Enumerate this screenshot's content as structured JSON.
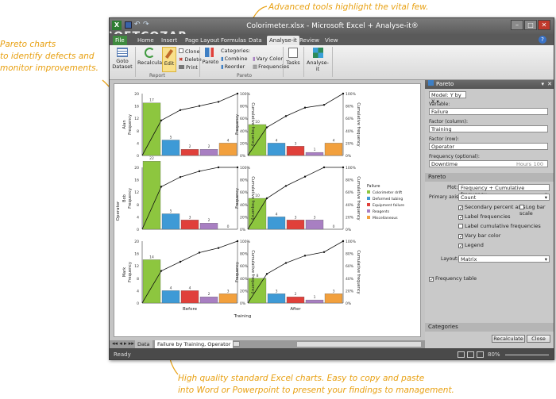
{
  "callouts": {
    "top": "Advanced tools highlight the vital few.",
    "left_line1": "Pareto charts",
    "left_line2": "to identify defects and",
    "left_line3": "monitor improvements.",
    "bottom_line1": "High quality standard Excel charts. Easy to copy and paste",
    "bottom_line2": "into Word or Powerpoint to present your findings to management."
  },
  "watermark": "SOFTCOZAR",
  "window": {
    "title": "Colorimeter.xlsx - Microsoft Excel + Analyse-it®"
  },
  "tabs": [
    "File",
    "Home",
    "Insert",
    "Page Layout",
    "Formulas",
    "Data",
    "Analyse-it",
    "Review",
    "View"
  ],
  "ribbon": {
    "goto_dataset": "Goto Dataset",
    "recalculate": "Recalculate",
    "edit": "Edit",
    "clone": "Clone",
    "delete": "Delete",
    "print": "Print",
    "report_group": "Report",
    "pareto": "Pareto",
    "categories": "Categories:",
    "combine": "Combine",
    "reorder": "Reorder",
    "vary_color": "Vary Color",
    "frequencies": "Frequencies",
    "pareto_group": "Pareto",
    "tasks": "Tasks",
    "analyse_it": "Analyse-it"
  },
  "sheet_tabs": {
    "data": "Data",
    "active": "Failure by Training, Operator"
  },
  "status": {
    "ready": "Ready",
    "zoom": "80%"
  },
  "chart_data": {
    "type": "bar",
    "categories": [
      "Colorimeter drift",
      "Deformed tubing",
      "Equipment failure",
      "Reagents",
      "Miscellaneous"
    ],
    "category_colors": [
      "#8dc63f",
      "#3e9ad6",
      "#e0403a",
      "#a87fc2",
      "#f2a03d"
    ],
    "legend_title": "Failure",
    "x_group_label": "Training",
    "row_axis_label": "Operator",
    "y_axis_label": "Frequency",
    "y2_axis_label": "Cumulative frequency",
    "y_ticks": [
      0,
      2,
      4,
      6,
      8,
      10,
      12,
      14,
      16,
      18,
      20
    ],
    "y2_ticks": [
      "0%",
      "20%",
      "40%",
      "60%",
      "80%",
      "100%"
    ],
    "x_groups": [
      "Before",
      "After"
    ],
    "row_labels": [
      "Alan",
      "Bob",
      "Mark"
    ],
    "panels": [
      {
        "row": "Alan",
        "col": "Before",
        "values": [
          17,
          5,
          2,
          2,
          4
        ]
      },
      {
        "row": "Alan",
        "col": "After",
        "values": [
          10,
          4,
          3,
          1,
          4
        ]
      },
      {
        "row": "Bob",
        "col": "Before",
        "values": [
          22,
          5,
          3,
          2,
          0
        ]
      },
      {
        "row": "Bob",
        "col": "After",
        "values": [
          10,
          4,
          3,
          3,
          0
        ]
      },
      {
        "row": "Mark",
        "col": "Before",
        "values": [
          14,
          4,
          4,
          2,
          3
        ]
      },
      {
        "row": "Mark",
        "col": "After",
        "values": [
          8,
          3,
          2,
          1,
          3
        ]
      }
    ]
  },
  "panel": {
    "title": "Pareto",
    "model": "Model: Y by X",
    "variable_label": "Variable:",
    "variable_value": "Failure",
    "factor_col_label": "Factor (column):",
    "factor_col_value": "Training",
    "factor_row_label": "Factor (row):",
    "factor_row_value": "Operator",
    "freq_label": "Frequency (optional):",
    "freq_value": "Downtime",
    "freq_hint": "Hours",
    "freq_units": "100",
    "section_pareto": "Pareto",
    "plot_label": "Plot:",
    "plot_value": "Frequency + Cumulative frequency",
    "primary_axis_label": "Primary axis:",
    "primary_axis_value": "Count",
    "secondary_percent_axis": "Secondary percent axis",
    "log_bar_axis": "Log bar scale",
    "label_frequencies": "Label frequencies",
    "label_cumulative": "Label cumulative frequencies",
    "vary_bar_color": "Vary bar color",
    "legend": "Legend",
    "layout_label": "Layout:",
    "layout_value": "Matrix",
    "frequency_table": "Frequency table",
    "categories_section": "Categories",
    "recalculate": "Recalculate",
    "close": "Close"
  }
}
